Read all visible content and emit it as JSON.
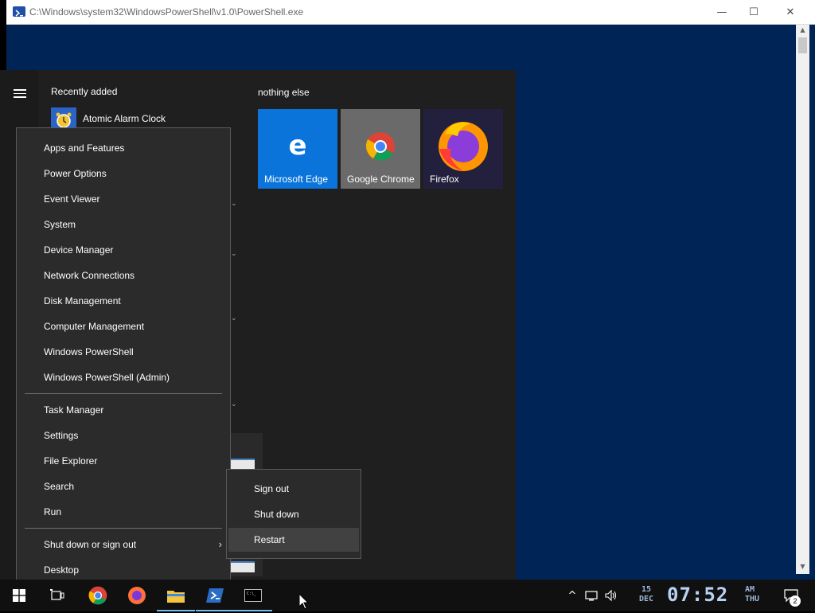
{
  "powershell": {
    "title": "C:\\Windows\\system32\\WindowsPowerShell\\v1.0\\PowerShell.exe",
    "bg_color": "#012456",
    "controls": {
      "minimize": "—",
      "maximize": "☐",
      "close": "✕"
    }
  },
  "start_menu": {
    "recently_added_label": "Recently added",
    "recent_app": "Atomic Alarm Clock",
    "group_title": "nothing else",
    "tiles": [
      {
        "label": "Microsoft Edge",
        "color": "#0a74da",
        "icon": "edge-icon"
      },
      {
        "label": "Google Chrome",
        "color": "#6a6a6a",
        "icon": "chrome-icon"
      },
      {
        "label": "Firefox",
        "color": "#22203c",
        "icon": "firefox-icon"
      }
    ]
  },
  "context_menu": {
    "items": [
      "Apps and Features",
      "Power Options",
      "Event Viewer",
      "System",
      "Device Manager",
      "Network Connections",
      "Disk Management",
      "Computer Management",
      "Windows PowerShell",
      "Windows PowerShell (Admin)",
      "Task Manager",
      "Settings",
      "File Explorer",
      "Search",
      "Run",
      "Shut down or sign out",
      "Desktop"
    ],
    "submenu_arrow": "›"
  },
  "submenu": {
    "items": [
      "Sign out",
      "Shut down",
      "Restart"
    ],
    "highlighted": "Restart"
  },
  "taskbar": {
    "apps": [
      "start-icon",
      "task-view-icon",
      "chrome-icon",
      "firefox-icon",
      "file-explorer-icon",
      "powershell-icon",
      "console-icon"
    ],
    "tray_chevron": "^",
    "clock": {
      "day": "15",
      "month": "DEC",
      "time": "07:52",
      "ampm": "AM",
      "weekday": "THU"
    },
    "notifications": "2"
  }
}
